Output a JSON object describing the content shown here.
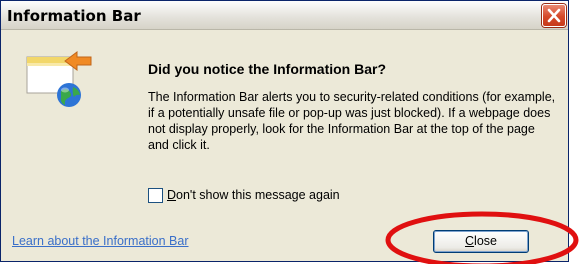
{
  "window": {
    "title": "Information Bar"
  },
  "main": {
    "heading": "Did you notice the Information Bar?",
    "paragraph": "The Information Bar alerts you to security-related conditions (for example, if a potentially unsafe file or pop-up was just blocked). If a webpage does not display properly, look for the Information Bar at the top of the page and click it.",
    "checkbox": {
      "label_first": "D",
      "label_rest": "on't show this message again",
      "checked": false
    }
  },
  "footer": {
    "learn_link": "Learn about the Information Bar",
    "close_first": "C",
    "close_rest": "lose"
  },
  "icons": {
    "info_bar": "information-bar-icon",
    "close": "close-icon"
  },
  "colors": {
    "highlight_ellipse": "#e01010",
    "link": "#3a6fc9"
  }
}
